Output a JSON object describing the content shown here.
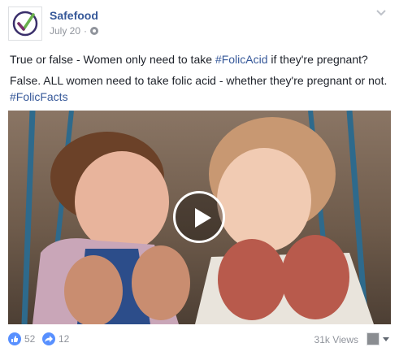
{
  "post": {
    "page_name": "Safefood",
    "date": "July 20",
    "separator": "·",
    "text": {
      "line1_prefix": "True or false - Women only need to take ",
      "line1_hashtag": "#FolicAcid",
      "line1_suffix": " if they're pregnant?",
      "line2": "False. ALL women need to take folic acid - whether they're pregnant or not.",
      "line3_hashtag": "#FolicFacts"
    }
  },
  "footer": {
    "likes": "52",
    "shares": "12",
    "views": "31k Views"
  },
  "colors": {
    "link": "#365899",
    "meta": "#90949c",
    "reaction_blue": "#5890ff"
  },
  "icons": {
    "avatar": "safefood-check-logo",
    "privacy": "globe-icon",
    "menu": "chevron-down-icon",
    "play": "play-icon",
    "like": "thumbs-up-icon",
    "share": "share-arrow-icon"
  }
}
